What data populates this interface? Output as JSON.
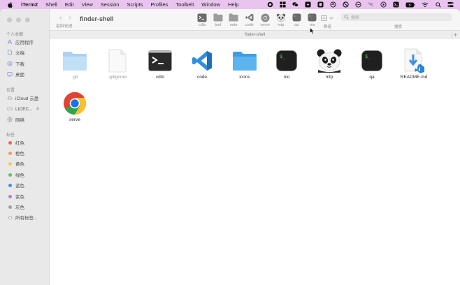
{
  "menubar": {
    "items": [
      "iTerm2",
      "Shell",
      "Edit",
      "View",
      "Session",
      "Scripts",
      "Profiles",
      "Toolbelt",
      "Window",
      "Help"
    ],
    "active_app": "iTerm2",
    "status_icons": [
      "record-icon",
      "grid-icon",
      "wechat-icon",
      "bolt-icon",
      "outline-icon",
      "circle-icon",
      "no-entry-icon",
      "dots-icon",
      "wifi-slash-icon",
      "play-icon",
      "terminal-icon",
      "battery-icon",
      "wifi-icon",
      "search-icon",
      "control-center-icon"
    ]
  },
  "window": {
    "title": "finder-shell",
    "nav_caption": "返回/前进",
    "toolbar": [
      {
        "label": "cdto",
        "icon": "terminal-icon"
      },
      {
        "label": "tool",
        "icon": "folder-icon"
      },
      {
        "label": "note",
        "icon": "folder-icon"
      },
      {
        "label": "code",
        "icon": "vscode-icon"
      },
      {
        "label": "serve",
        "icon": "chrome-icon"
      },
      {
        "label": "mtp",
        "icon": "panda-icon"
      },
      {
        "label": "qa",
        "icon": "terminal-icon"
      },
      {
        "label": "mo",
        "icon": "terminal-icon"
      }
    ],
    "group_caption": "群组",
    "search_placeholder": "搜索",
    "search_caption": "搜索",
    "path_label": "finder-shell"
  },
  "sidebar": {
    "favorites_header": "个人收藏",
    "favorites": [
      {
        "label": "应用程序",
        "icon": "apps-icon"
      },
      {
        "label": "文稿",
        "icon": "doc-icon"
      },
      {
        "label": "下载",
        "icon": "download-icon"
      },
      {
        "label": "桌面",
        "icon": "desktop-icon"
      }
    ],
    "locations_header": "位置",
    "locations": [
      {
        "label": "iCloud 云盘",
        "icon": "cloud-icon"
      },
      {
        "label": "LICEC...",
        "icon": "disk-icon"
      },
      {
        "label": "网络",
        "icon": "network-icon"
      }
    ],
    "tags_header": "标签",
    "tags": [
      {
        "label": "红色",
        "color": "#f0625b"
      },
      {
        "label": "橙色",
        "color": "#f6a23a"
      },
      {
        "label": "黄色",
        "color": "#f5cf3a"
      },
      {
        "label": "绿色",
        "color": "#5fc55a"
      },
      {
        "label": "蓝色",
        "color": "#3d8df5"
      },
      {
        "label": "紫色",
        "color": "#b77cd9"
      },
      {
        "label": "灰色",
        "color": "#a0a0a0"
      },
      {
        "label": "所有标签...",
        "color": "#ffffff"
      }
    ]
  },
  "files": [
    {
      "name": ".git",
      "kind": "folder-light",
      "dim": true
    },
    {
      "name": ".gitignore",
      "kind": "document",
      "dim": true
    },
    {
      "name": "cdto",
      "kind": "terminal-app",
      "dim": false
    },
    {
      "name": "code",
      "kind": "vscode-app",
      "dim": false
    },
    {
      "name": "icons",
      "kind": "folder",
      "dim": false
    },
    {
      "name": "mo",
      "kind": "terminal-dark",
      "dim": false
    },
    {
      "name": "mtp",
      "kind": "panda",
      "dim": false
    },
    {
      "name": "qa",
      "kind": "terminal-dark",
      "dim": false
    },
    {
      "name": "README.md",
      "kind": "markdown",
      "dim": false
    },
    {
      "name": "serve",
      "kind": "chrome",
      "dim": false
    }
  ]
}
